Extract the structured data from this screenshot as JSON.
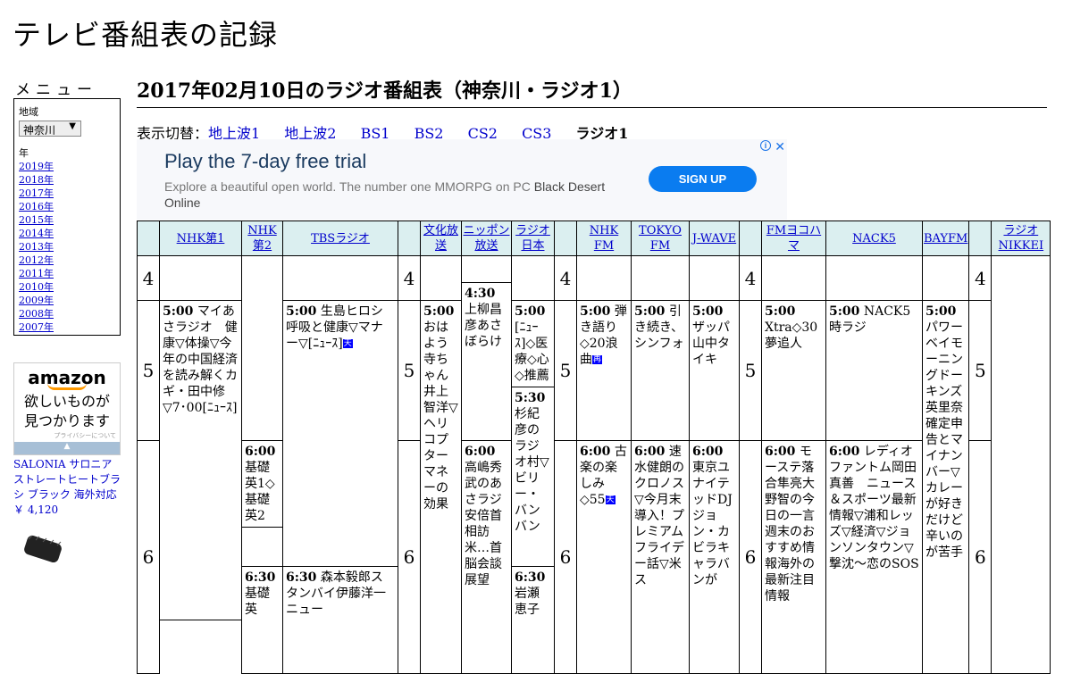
{
  "site": {
    "title": "テレビ番組表の記録"
  },
  "menu": {
    "title": "メニュー",
    "region_label": "地域",
    "region_value": "神奈川",
    "year_label": "年",
    "years": [
      "2019年",
      "2018年",
      "2017年",
      "2016年",
      "2015年",
      "2014年",
      "2013年",
      "2012年",
      "2011年",
      "2010年",
      "2009年",
      "2008年",
      "2007年"
    ]
  },
  "amazon_ad": {
    "logo": "amazon",
    "message_line1": "欲しいものが",
    "message_line2": "見つかります",
    "privacy": "プライバシーについて",
    "product_name": "SALONIA サロニア ストレートヒートブラシ ブラック 海外対応",
    "product_price": "￥ 4,120"
  },
  "page": {
    "heading": "2017年02月10日のラジオ番組表（神奈川・ラジオ1）",
    "switch_label": "表示切替：",
    "switch_links": [
      "地上波1",
      "地上波2",
      "BS1",
      "BS2",
      "CS2",
      "CS3"
    ],
    "switch_current": "ラジオ1"
  },
  "ad": {
    "title": "Play the 7-day free trial",
    "desc": "Explore a beautiful open world. The number one MMORPG on PC ",
    "brand": "Black Desert Online",
    "button": "SIGN UP",
    "info": "i",
    "close": "✕"
  },
  "schedule": {
    "channels": [
      "NHK第1",
      "NHK第2",
      "TBSラジオ",
      "文化放送",
      "ニッポン放送",
      "ラジオ日本",
      "NHK FM",
      "TOKYO FM",
      "J-WAVE",
      "FMヨコハマ",
      "NACK5",
      "BAYFM",
      "ラジオNIKKEI"
    ],
    "hours": [
      "4",
      "5",
      "6"
    ],
    "programs": {
      "nhk1_500": {
        "time": "5:00",
        "title": "マイあさラジオ　健康▽体操▽今年の中国経済を読み解くカギ・田中修▽7･00[ﾆｭｰｽ]"
      },
      "tbs_500": {
        "time": "5:00",
        "title": "生島ヒロシ　呼吸と健康▽マナー▽[ﾆｭｰｽ]",
        "mark": "天"
      },
      "tbs_630": {
        "time": "6:30",
        "title": "森本毅郎スタンバイ伊藤洋一ニュー"
      },
      "nhk2_600": {
        "time": "6:00",
        "title": "基礎英1◇基礎英2"
      },
      "nhk2_630": {
        "time": "6:30",
        "title": "基礎英"
      },
      "bunka_500": {
        "time": "5:00",
        "title": "おはよう寺ちゃん井上智洋▽ヘリコプターマネーの効果"
      },
      "nippon_430": {
        "time": "4:30",
        "title": "上柳昌彦あさぼらけ"
      },
      "nippon_600": {
        "time": "6:00",
        "title": "高嶋秀武のあさラジ安倍首相訪米…首脳会談展望"
      },
      "rnippon_500": {
        "time": "5:00",
        "title": "[ﾆｭｰｽ]◇医療◇心◇推薦"
      },
      "rnippon_530": {
        "time": "5:30",
        "title": "杉紀彦のラジオ村▽ビリー・バンバン"
      },
      "rnippon_630": {
        "time": "6:30",
        "title": "岩瀬恵子"
      },
      "nhkfm_500": {
        "time": "5:00",
        "title": "弾き語り◇20浪曲",
        "mark": "再"
      },
      "nhkfm_600": {
        "time": "6:00",
        "title": "古楽の楽しみ◇55",
        "mark": "天"
      },
      "tokyofm_500": {
        "time": "5:00",
        "title": "引き続き、シンフォ"
      },
      "tokyofm_600": {
        "time": "6:00",
        "title": "速水健朗のクロノス▽今月末導入！プレミアムフライデー話▽米ス"
      },
      "jwave_500": {
        "time": "5:00",
        "title": "ザッパ山中タイキ"
      },
      "jwave_600": {
        "time": "6:00",
        "title": "東京ユナイテッドDJジョン・カビラキャラバンが"
      },
      "fmy_500": {
        "time": "5:00",
        "title": "Xtra◇30夢追人"
      },
      "fmy_600": {
        "time": "6:00",
        "title": "モーステ落合隼亮大野智の今日の一言週末のおすすめ情報海外の最新注目情報"
      },
      "nack5_500": {
        "time": "5:00",
        "title": "NACK5時ラジ"
      },
      "nack5_600": {
        "time": "6:00",
        "title": "レディオファントム岡田真善　ニュース＆スポーツ最新情報▽浦和レッズ▽経済▽ジョンソンタウン▽撃沈〜恋のSOS"
      },
      "bayfm_500": {
        "time": "5:00",
        "title": "パワーベイモーニングドーキンズ英里奈確定申告とマイナンバー▽カレーが好きだけど辛いのが苦手"
      }
    }
  }
}
